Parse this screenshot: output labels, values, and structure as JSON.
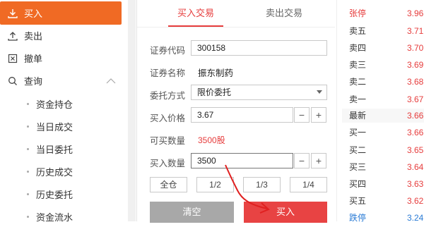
{
  "sidebar": {
    "items": [
      {
        "label": "买入",
        "icon": "download-icon"
      },
      {
        "label": "卖出",
        "icon": "upload-icon"
      },
      {
        "label": "撤单",
        "icon": "cancel-box-icon"
      },
      {
        "label": "查询",
        "icon": "search-icon"
      }
    ],
    "sub_items": [
      "资金持仓",
      "当日成交",
      "当日委托",
      "历史成交",
      "历史委托",
      "资金流水"
    ]
  },
  "tabs": {
    "buy": "买入交易",
    "sell": "卖出交易"
  },
  "form": {
    "code_label": "证券代码",
    "code_value": "300158",
    "name_label": "证券名称",
    "name_value": "振东制药",
    "mode_label": "委托方式",
    "mode_value": "限价委托",
    "price_label": "买入价格",
    "price_value": "3.67",
    "avail_label": "可买数量",
    "avail_value": "3500股",
    "qty_label": "买入数量",
    "qty_value": "3500",
    "minus": "−",
    "plus": "+",
    "quick": [
      "全仓",
      "1/2",
      "1/3",
      "1/4"
    ],
    "clear_label": "清空",
    "buy_label": "买入"
  },
  "quotes": [
    {
      "label": "张停",
      "value": "3.96",
      "label_color": "#e63c3c"
    },
    {
      "label": "卖五",
      "value": "3.71"
    },
    {
      "label": "卖四",
      "value": "3.70"
    },
    {
      "label": "卖三",
      "value": "3.69"
    },
    {
      "label": "卖二",
      "value": "3.68"
    },
    {
      "label": "卖一",
      "value": "3.67"
    },
    {
      "label": "最新",
      "value": "3.66"
    },
    {
      "label": "买一",
      "value": "3.66"
    },
    {
      "label": "买二",
      "value": "3.65"
    },
    {
      "label": "买三",
      "value": "3.64"
    },
    {
      "label": "买四",
      "value": "3.63"
    },
    {
      "label": "买五",
      "value": "3.62"
    },
    {
      "label": "跌停",
      "value": "3.24",
      "label_color": "#2a7bd5",
      "value_color": "#2a7bd5"
    }
  ],
  "colors": {
    "accent": "#f06a24",
    "red": "#e63c3c",
    "blue": "#2a7bd5"
  }
}
